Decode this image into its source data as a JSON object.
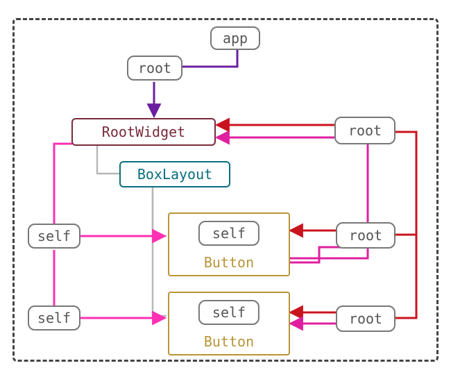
{
  "nodes": {
    "app": "app",
    "root_top": "root",
    "root_widget": "RootWidget",
    "box_layout": "BoxLayout",
    "root_right_top": "root",
    "root_right_mid": "root",
    "root_right_bot": "root",
    "self_left_1": "self",
    "self_left_2": "self",
    "button1_self": "self",
    "button1_label": "Button",
    "button2_self": "self",
    "button2_label": "Button"
  },
  "colors": {
    "dashed_border": "#444444",
    "gray": "#777777",
    "maroon": "#7a2a3a",
    "teal": "#0a6e7d",
    "gold": "#b99438",
    "purple_arrow": "#6a1fa0",
    "pink_arrow": "#ff2fb3",
    "magenta_arrow": "#e01fa0",
    "red_arrow": "#c9141f",
    "light_gray_line": "#b8b8b8"
  },
  "edges": [
    {
      "from": "app",
      "to": "root_top",
      "color": "purple"
    },
    {
      "from": "root_top",
      "to": "root_widget",
      "color": "purple"
    },
    {
      "from": "root_widget",
      "to": "box_layout",
      "color": "gray_line"
    },
    {
      "from": "box_layout",
      "to": "button1",
      "color": "gray_line"
    },
    {
      "from": "box_layout",
      "to": "button2",
      "color": "gray_line"
    },
    {
      "from": "root_right_top",
      "to": "root_widget",
      "color": "red"
    },
    {
      "from": "root_right_top",
      "to": "root_widget",
      "color": "magenta"
    },
    {
      "from": "root_right_mid",
      "to": "button1",
      "color": "red"
    },
    {
      "from": "root_right_mid",
      "to": "button1",
      "color": "magenta"
    },
    {
      "from": "root_right_bot",
      "to": "button2",
      "color": "red"
    },
    {
      "from": "root_right_bot",
      "to": "button2",
      "color": "magenta"
    },
    {
      "from": "self_left_1",
      "to": "button1",
      "color": "pink"
    },
    {
      "from": "self_left_2",
      "to": "button2",
      "color": "pink"
    },
    {
      "from": "root_widget",
      "to": "self_left_1",
      "color": "pink"
    },
    {
      "from": "root_widget",
      "to": "self_left_2",
      "color": "pink"
    },
    {
      "from": "root_right_top",
      "to": "root_right_mid",
      "color": "red_chain"
    },
    {
      "from": "root_right_top",
      "to": "root_right_bot",
      "color": "red_chain"
    }
  ],
  "description": "Widget tree diagram showing app → root → RootWidget → BoxLayout → two Button groups, with self/root reference arrows."
}
